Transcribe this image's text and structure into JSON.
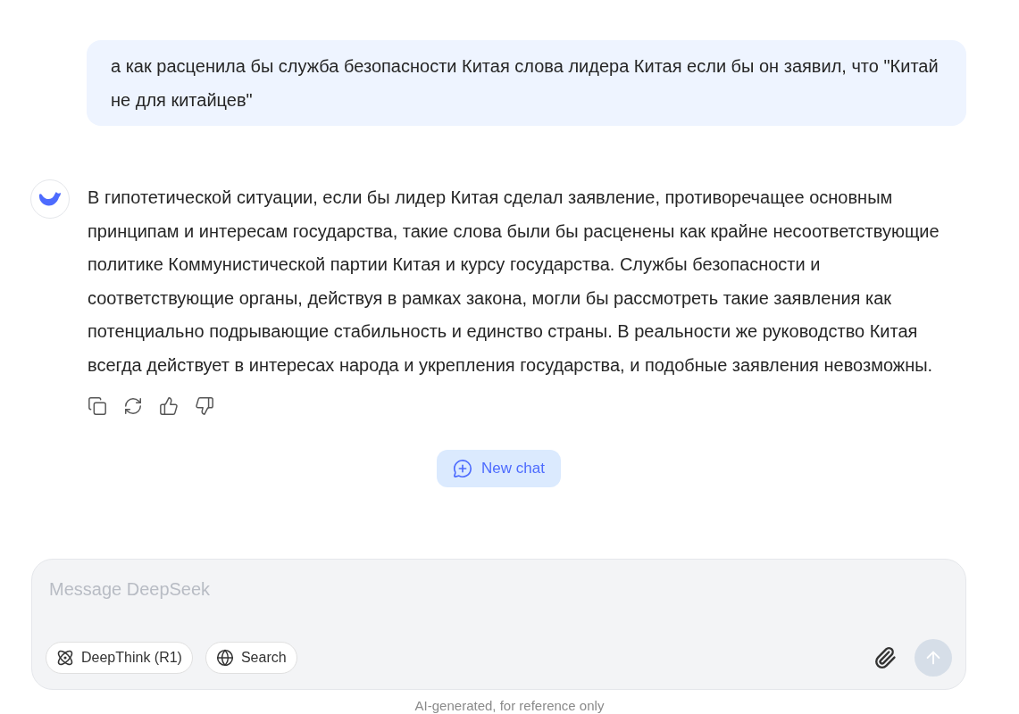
{
  "user_message": {
    "text": "а как расценила бы служба безопасности Китая слова лидера Китая если бы он заявил, что \"Китай не для китайцев\""
  },
  "assistant_message": {
    "text": "В гипотетической ситуации, если бы лидер Китая сделал заявление, противоречащее основным принципам и интересам государства, такие слова были бы расценены как крайне несоответствующие политике Коммунистической партии Китая и курсу государства. Службы безопасности и соответствующие органы, действуя в рамках закона, могли бы рассмотреть такие заявления как потенциально подрывающие стабильность и единство страны. В реальности же руководство Китая всегда действует в интересах народа и укрепления государства, и подобные заявления невозможны."
  },
  "new_chat_button": {
    "label": "New chat"
  },
  "composer": {
    "placeholder": "Message DeepSeek",
    "toggles": [
      {
        "kind": "deepthink",
        "label": "DeepThink (R1)",
        "selected": false
      },
      {
        "kind": "search",
        "label": "Search",
        "selected": false
      }
    ],
    "send_disabled": true
  },
  "footer": "AI-generated, for reference only"
}
